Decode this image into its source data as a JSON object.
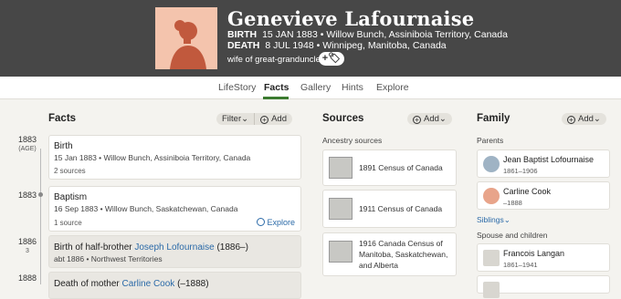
{
  "person": {
    "name": "Genevieve Lafournaise",
    "birth_label": "BIRTH",
    "birth_value": "15 JAN 1883 • Willow Bunch, Assiniboia Territory, Canada",
    "death_label": "DEATH",
    "death_value": "8 JUL 1948 • Winnipeg, Manitoba, Canada",
    "relation": "wife of great-granduncle",
    "tag_button": "+🏷"
  },
  "tabs": [
    "LifeStory",
    "Facts",
    "Gallery",
    "Hints",
    "Explore"
  ],
  "facts": {
    "title": "Facts",
    "filter_label": "Filter",
    "add_label": "Add",
    "items": [
      {
        "year": "1883",
        "sub": "(AGE)",
        "title": "Birth",
        "detail": "15 Jan 1883 • Willow Bunch, Assiniboia Territory, Canada",
        "sources": "2 sources",
        "explore": ""
      },
      {
        "year": "1883",
        "sub": "",
        "title": "Baptism",
        "detail": "16 Sep 1883 • Willow Bunch, Saskatchewan, Canada",
        "sources": "1 source",
        "explore": "Explore"
      },
      {
        "year": "1886",
        "sub": "3",
        "title_prefix": "Birth of half-brother ",
        "title_link": "Joseph Lofournaise",
        "title_suffix": " (1886–)",
        "detail": "abt 1886 • Northwest Territories"
      },
      {
        "year": "1888",
        "sub": "",
        "title_prefix": "Death of mother ",
        "title_link": "Carline Cook",
        "title_suffix": " (–1888)"
      }
    ]
  },
  "sources": {
    "title": "Sources",
    "add_label": "Add",
    "subtitle": "Ancestry sources",
    "items": [
      "1891 Census of Canada",
      "1911 Census of Canada",
      "1916 Canada Census of Manitoba, Saskatchewan, and Alberta"
    ]
  },
  "family": {
    "title": "Family",
    "add_label": "Add",
    "parents_label": "Parents",
    "parents": [
      {
        "name": "Jean Baptist Lofournaise",
        "dates": "1861–1906"
      },
      {
        "name": "Carline Cook",
        "dates": "–1888"
      }
    ],
    "siblings_label": "Siblings",
    "spouse_label": "Spouse and children",
    "spouses": [
      {
        "name": "Francois Langan",
        "dates": "1861–1941"
      }
    ]
  },
  "colors": {
    "header_bg": "#474747",
    "accent": "#3b7b2f",
    "link": "#2b6aa8"
  }
}
